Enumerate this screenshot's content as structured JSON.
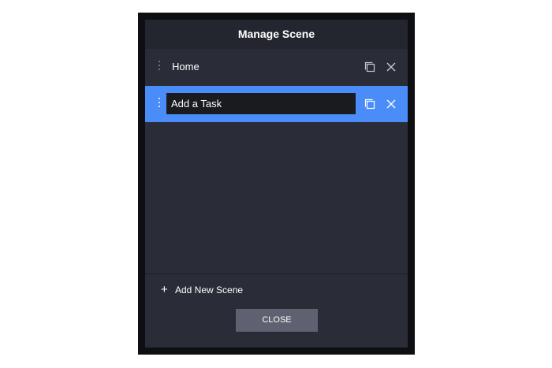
{
  "dialog": {
    "title": "Manage Scene"
  },
  "scenes": [
    {
      "label": "Home",
      "state": "normal"
    },
    {
      "label": "Add a Task",
      "state": "editing"
    }
  ],
  "actions": {
    "add_new_scene": "Add New Scene",
    "close": "CLOSE"
  },
  "icons": {
    "drag": "drag-handle-icon",
    "copy": "copy-icon",
    "delete": "close-icon",
    "add": "plus-icon"
  },
  "colors": {
    "accent": "#4b8df8",
    "panel": "#2a2d38",
    "header": "#23262f",
    "input_bg": "#1a1b1f",
    "button": "#5d6170"
  }
}
